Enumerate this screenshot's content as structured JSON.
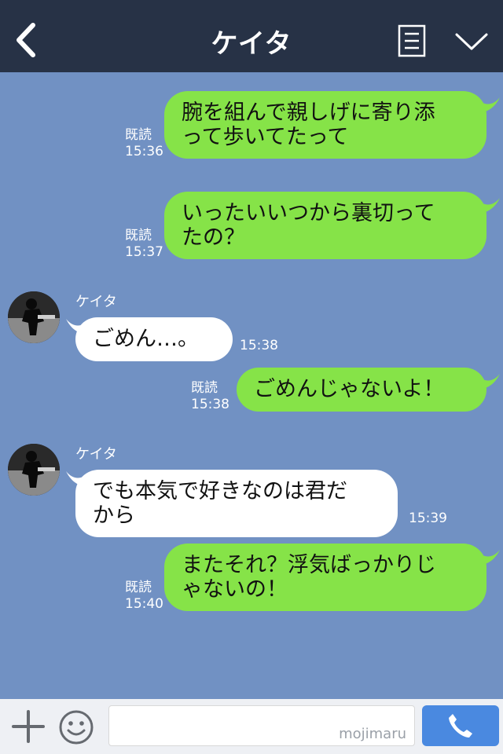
{
  "header": {
    "title": "ケイタ",
    "back_icon": "chevron-left-icon",
    "menu_icon": "menu-list-icon",
    "collapse_icon": "chevron-down-icon"
  },
  "messages": [
    {
      "side": "out",
      "read": "既読",
      "time": "15:36",
      "lines": [
        "腕を組んで親しげに寄り添",
        "って歩いてたって"
      ]
    },
    {
      "side": "out",
      "read": "既読",
      "time": "15:37",
      "lines": [
        "いったいいつから裏切って",
        "たの？"
      ]
    },
    {
      "side": "in",
      "sender": "ケイタ",
      "time": "15:38",
      "lines": [
        "ごめん…。"
      ]
    },
    {
      "side": "out",
      "read": "既読",
      "time": "15:38",
      "lines": [
        "ごめんじゃないよ！"
      ]
    },
    {
      "side": "in",
      "sender": "ケイタ",
      "time": "15:39",
      "lines": [
        "でも本気で好きなのは君だ",
        "から"
      ]
    },
    {
      "side": "out",
      "read": "既読",
      "time": "15:40",
      "lines": [
        "またそれ？浮気ばっかりじ",
        "ゃないの！"
      ]
    }
  ],
  "footer": {
    "plus_icon": "plus-icon",
    "emoji_icon": "smile-icon",
    "input_value": "",
    "watermark": "mojimaru",
    "call_icon": "phone-icon"
  },
  "colors": {
    "header_bg": "#273246",
    "chat_bg": "#7191c3",
    "outgoing_bubble": "#86e348",
    "incoming_bubble": "#ffffff",
    "call_button": "#4a89e0"
  }
}
